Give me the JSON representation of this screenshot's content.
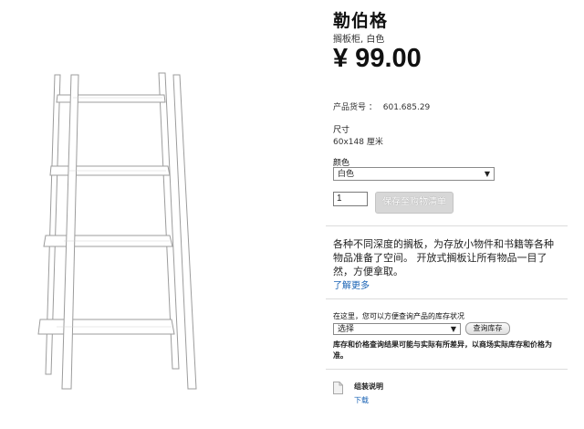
{
  "product": {
    "name": "勒伯格",
    "subtitle": "搁板柜, 白色",
    "price": "¥ 99.00",
    "article_label": "产品货号 ：",
    "article_number": "601.685.29"
  },
  "size": {
    "label": "尺寸",
    "value": "60x148 厘米"
  },
  "color": {
    "label": "颜色",
    "selected": "白色"
  },
  "purchase": {
    "quantity": "1",
    "add_to_cart_label": "保存至购物清单"
  },
  "description": {
    "text": "各种不同深度的搁板，为存放小物件和书籍等各种物品准备了空间。 开放式搁板让所有物品一目了然，方便拿取。",
    "more_link": "了解更多"
  },
  "stock": {
    "label": "在这里，您可以方便查询产品的库存状况",
    "store_selected": "选择",
    "check_button": "查询库存",
    "note": "库存和价格查询结果可能与实际有所差异，以商场实际库存和价格为准。"
  },
  "assembly": {
    "label": "组装说明",
    "download_link": "下载",
    "icon": "document-icon"
  }
}
